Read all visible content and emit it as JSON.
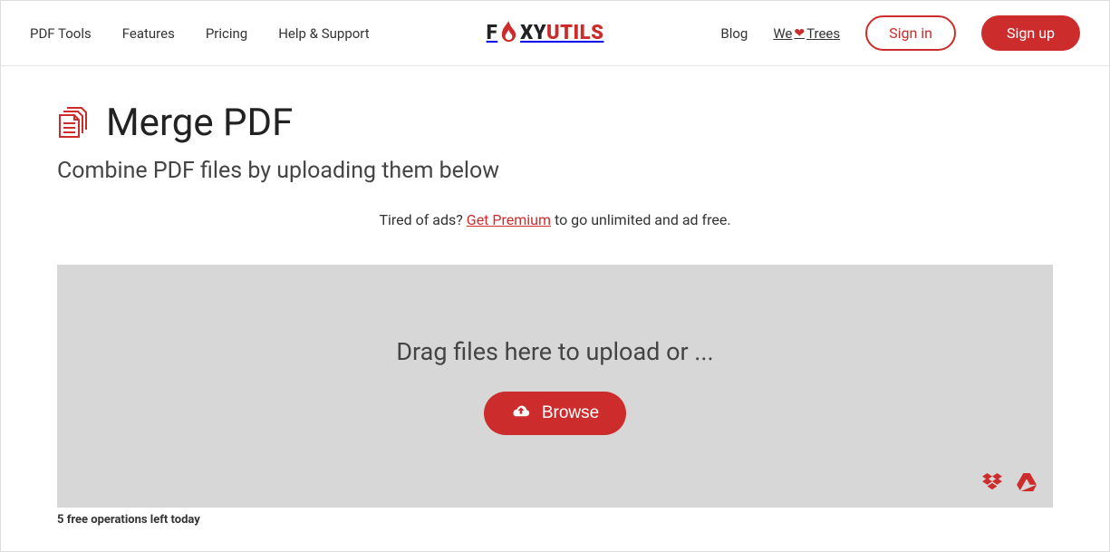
{
  "nav": {
    "left": [
      "PDF Tools",
      "Features",
      "Pricing",
      "Help & Support"
    ],
    "right": {
      "blog": "Blog",
      "we": "We",
      "trees": "Trees",
      "signin": "Sign in",
      "signup": "Sign up"
    }
  },
  "logo": {
    "f": "F",
    "xy": "XY",
    "utils": "UTILS"
  },
  "page": {
    "title": "Merge PDF",
    "subtitle": "Combine PDF files by uploading them below"
  },
  "premium": {
    "prefix": "Tired of ads? ",
    "link": "Get Premium",
    "suffix": " to go unlimited and ad free."
  },
  "dropzone": {
    "text": "Drag files here to upload or ...",
    "browse": "Browse"
  },
  "footer": {
    "note": "5 free operations left today"
  }
}
